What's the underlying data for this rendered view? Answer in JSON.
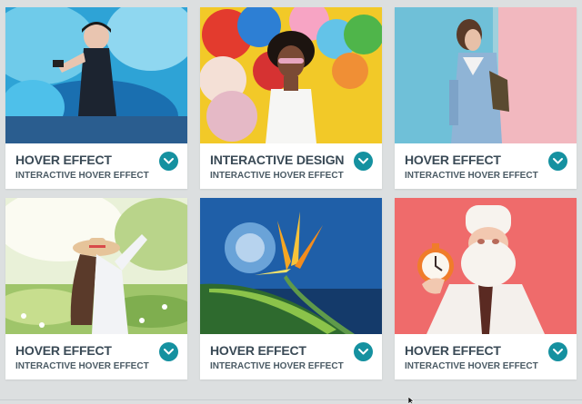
{
  "cards": [
    {
      "title": "HOVER EFFECT",
      "subtitle": "INTERACTIVE HOVER EFFECT",
      "image": "woman-with-blue-smoke-photo",
      "toggle_icon": "chevron-down-icon"
    },
    {
      "title": "INTERACTIVE DESIGN",
      "subtitle": "INTERACTIVE HOVER EFFECT",
      "image": "woman-with-balloons-photo",
      "toggle_icon": "chevron-down-icon"
    },
    {
      "title": "HOVER EFFECT",
      "subtitle": "INTERACTIVE HOVER EFFECT",
      "image": "woman-denim-jacket-photo",
      "toggle_icon": "chevron-down-icon"
    },
    {
      "title": "HOVER EFFECT",
      "subtitle": "INTERACTIVE HOVER EFFECT",
      "image": "woman-in-flower-field-photo",
      "toggle_icon": "chevron-down-icon"
    },
    {
      "title": "HOVER EFFECT",
      "subtitle": "INTERACTIVE HOVER EFFECT",
      "image": "bird-of-paradise-flower-photo",
      "toggle_icon": "chevron-down-icon"
    },
    {
      "title": "HOVER EFFECT",
      "subtitle": "INTERACTIVE HOVER EFFECT",
      "image": "santa-with-stopwatch-illustration",
      "toggle_icon": "chevron-down-icon"
    }
  ],
  "colors": {
    "page_background": "#dcdfe0",
    "card_background": "#ffffff",
    "title_text": "#3a4a56",
    "toggle_button": "#1591a0"
  }
}
